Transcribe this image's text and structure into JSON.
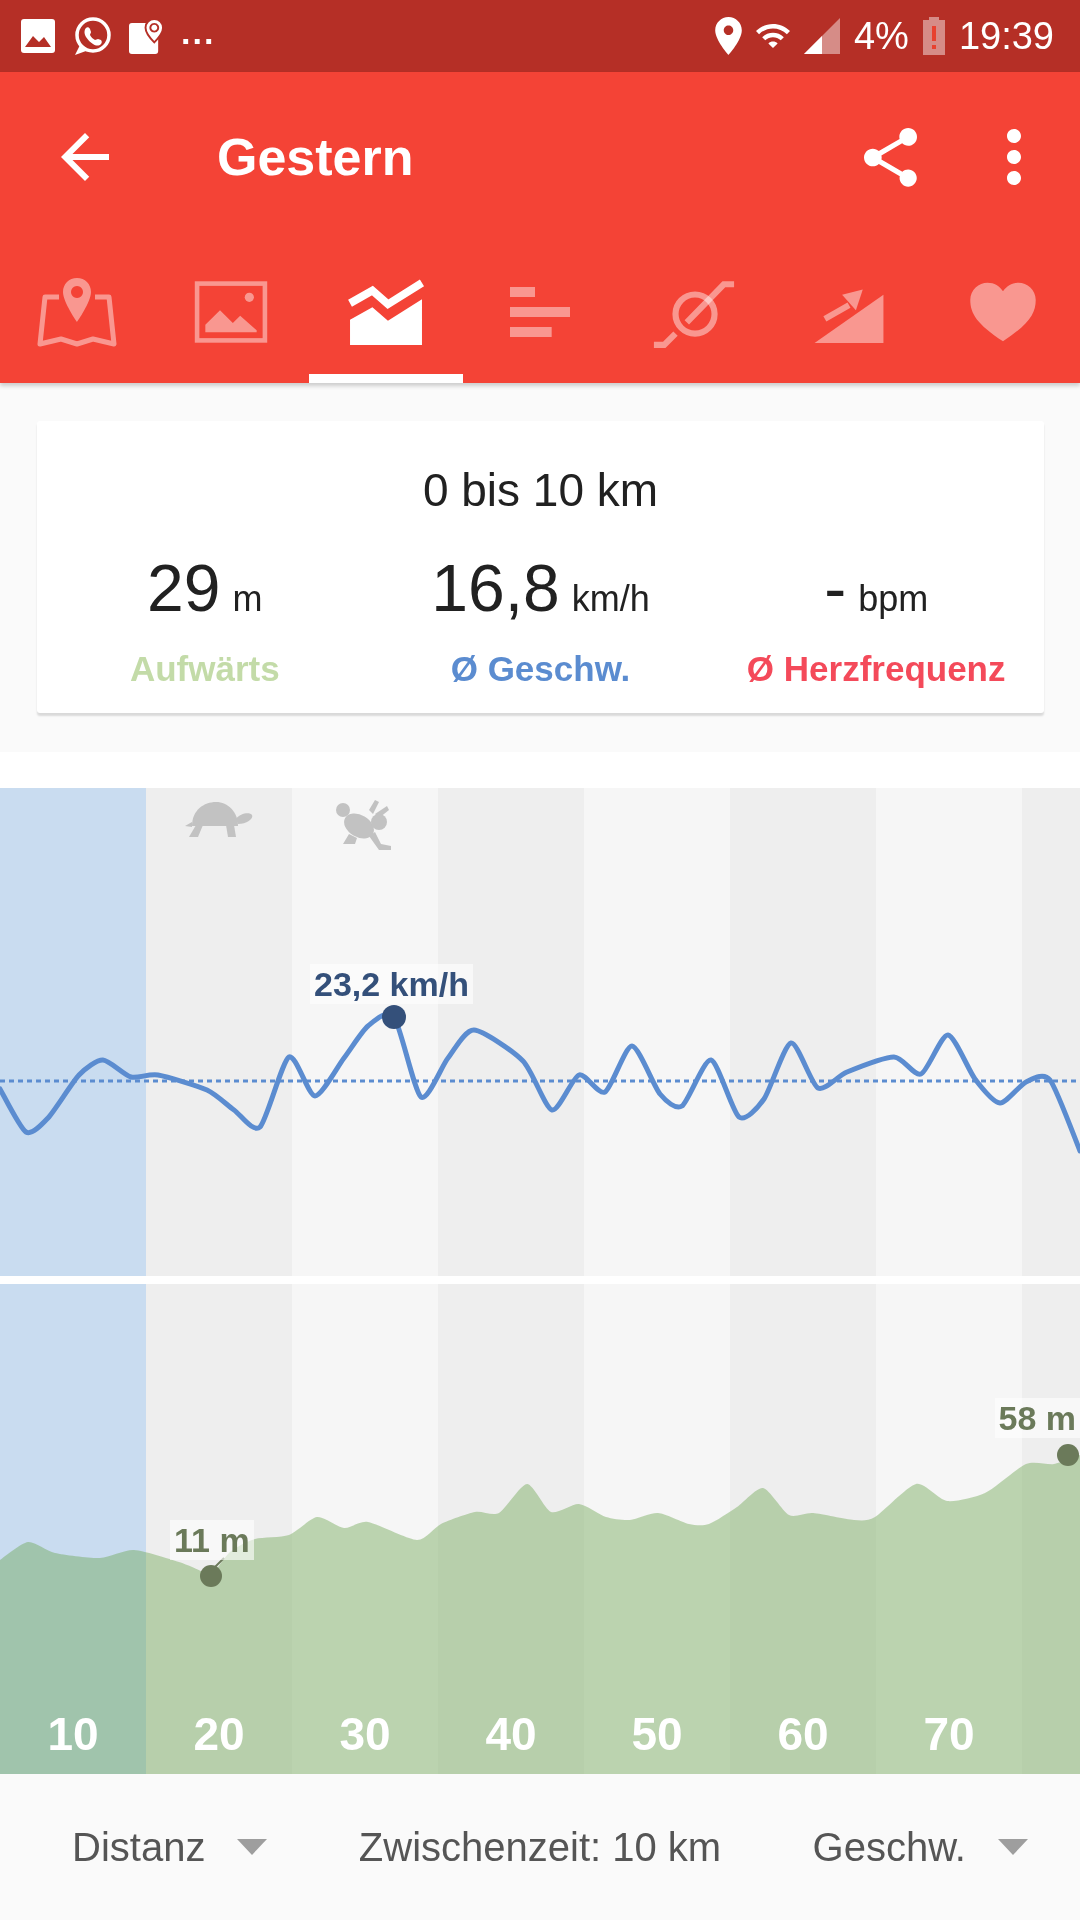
{
  "status_bar": {
    "overflow": "...",
    "battery": "4%",
    "time": "19:39"
  },
  "app_bar": {
    "title": "Gestern"
  },
  "tabs": [
    {
      "kind": "map",
      "selected": false
    },
    {
      "kind": "photos",
      "selected": false
    },
    {
      "kind": "graph",
      "selected": true
    },
    {
      "kind": "splits",
      "selected": false
    },
    {
      "kind": "compare",
      "selected": false
    },
    {
      "kind": "climb",
      "selected": false
    },
    {
      "kind": "heart_rate",
      "selected": false
    }
  ],
  "summary": {
    "title": "0 bis 10 km",
    "stats": [
      {
        "value": "29",
        "unit": "m",
        "label": "Aufwärts",
        "color": "#c3dba8"
      },
      {
        "value": "16,8",
        "unit": "km/h",
        "label": "Ø Geschw.",
        "color": "#5b8cd0"
      },
      {
        "value": "-",
        "unit": "bpm",
        "label": "Ø Herzfrequenz",
        "color": "#f44a5a"
      }
    ]
  },
  "splits": [
    {
      "label": "10",
      "selected": true,
      "slowest": false,
      "fastest": false
    },
    {
      "label": "20",
      "selected": false,
      "slowest": true,
      "fastest": false
    },
    {
      "label": "30",
      "selected": false,
      "slowest": false,
      "fastest": true
    },
    {
      "label": "40",
      "selected": false,
      "slowest": false,
      "fastest": false
    },
    {
      "label": "50",
      "selected": false,
      "slowest": false,
      "fastest": false
    },
    {
      "label": "60",
      "selected": false,
      "slowest": false,
      "fastest": false
    },
    {
      "label": "70",
      "selected": false,
      "slowest": false,
      "fastest": false
    }
  ],
  "speed_chart": {
    "max_label": "23,2 km/h"
  },
  "elevation_chart": {
    "min_label": "11 m",
    "max_label": "58 m"
  },
  "bottom_bar": [
    {
      "kind": "dropdown",
      "label": "Distanz"
    },
    {
      "kind": "text",
      "label": "Zwischenzeit: 10 km"
    },
    {
      "kind": "dropdown",
      "label": "Geschw."
    }
  ]
}
